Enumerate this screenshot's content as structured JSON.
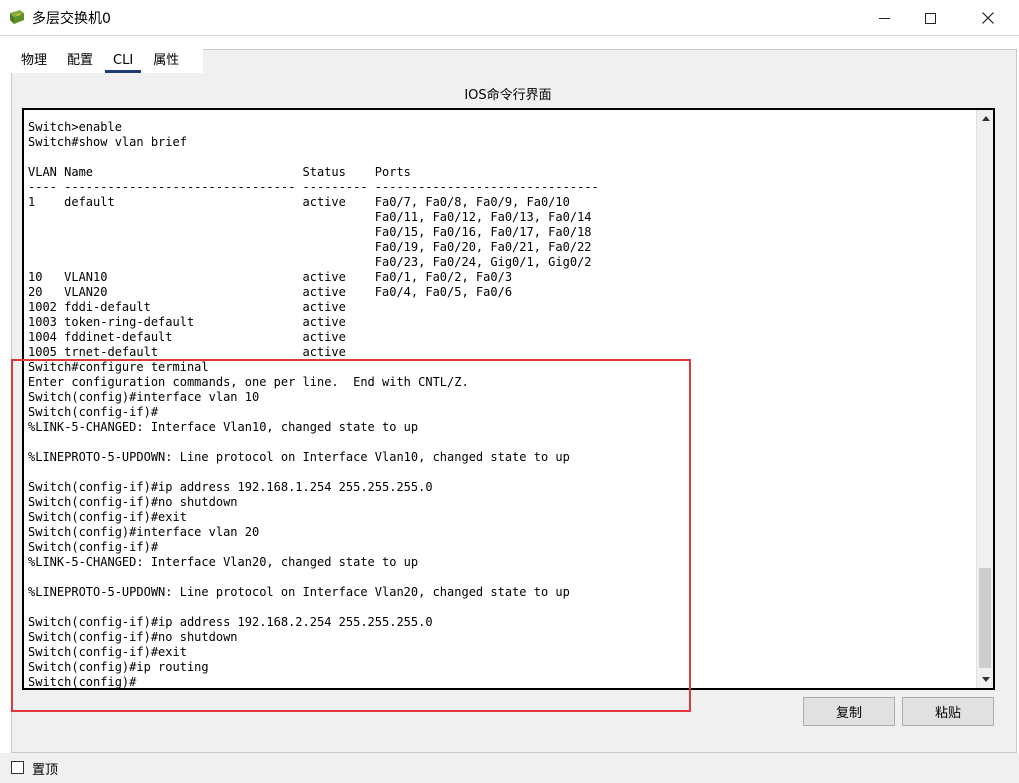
{
  "window": {
    "title": "多层交换机0",
    "icon": "switch-app-icon"
  },
  "tabs": [
    {
      "label": "物理",
      "active": false
    },
    {
      "label": "配置",
      "active": false
    },
    {
      "label": "CLI",
      "active": true
    },
    {
      "label": "属性",
      "active": false
    }
  ],
  "cli": {
    "heading": "IOS命令行界面",
    "lines": [
      "Switch>enable",
      "Switch#show vlan brief",
      "",
      "VLAN Name                             Status    Ports",
      "---- -------------------------------- --------- -------------------------------",
      "1    default                          active    Fa0/7, Fa0/8, Fa0/9, Fa0/10",
      "                                                Fa0/11, Fa0/12, Fa0/13, Fa0/14",
      "                                                Fa0/15, Fa0/16, Fa0/17, Fa0/18",
      "                                                Fa0/19, Fa0/20, Fa0/21, Fa0/22",
      "                                                Fa0/23, Fa0/24, Gig0/1, Gig0/2",
      "10   VLAN10                           active    Fa0/1, Fa0/2, Fa0/3",
      "20   VLAN20                           active    Fa0/4, Fa0/5, Fa0/6",
      "1002 fddi-default                     active",
      "1003 token-ring-default               active",
      "1004 fddinet-default                  active",
      "1005 trnet-default                    active",
      "Switch#configure terminal",
      "Enter configuration commands, one per line.  End with CNTL/Z.",
      "Switch(config)#interface vlan 10",
      "Switch(config-if)#",
      "%LINK-5-CHANGED: Interface Vlan10, changed state to up",
      "",
      "%LINEPROTO-5-UPDOWN: Line protocol on Interface Vlan10, changed state to up",
      "",
      "Switch(config-if)#ip address 192.168.1.254 255.255.255.0",
      "Switch(config-if)#no shutdown",
      "Switch(config-if)#exit",
      "Switch(config)#interface vlan 20",
      "Switch(config-if)#",
      "%LINK-5-CHANGED: Interface Vlan20, changed state to up",
      "",
      "%LINEPROTO-5-UPDOWN: Line protocol on Interface Vlan20, changed state to up",
      "",
      "Switch(config-if)#ip address 192.168.2.254 255.255.255.0",
      "Switch(config-if)#no shutdown",
      "Switch(config-if)#exit",
      "Switch(config)#ip routing",
      "Switch(config)#"
    ]
  },
  "buttons": {
    "copy": "复制",
    "paste": "粘贴"
  },
  "footer": {
    "pin_label": "置顶",
    "pin_checked": false
  },
  "colors": {
    "highlight": "#e0373a",
    "active_tab_underline": "#1f3c6e"
  }
}
